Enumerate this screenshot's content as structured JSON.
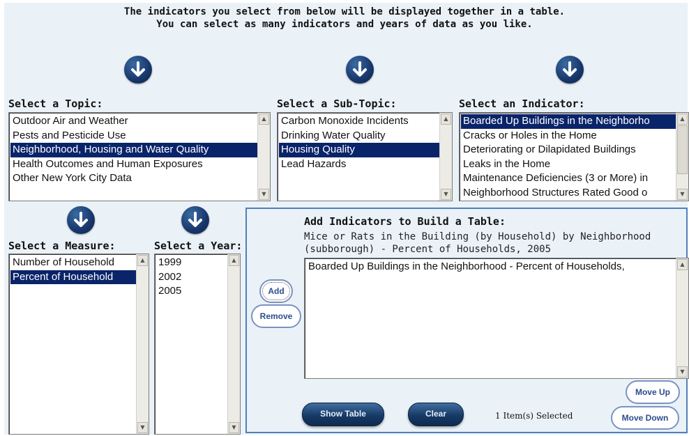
{
  "intro": {
    "line1": "The indicators you select from below will be displayed together in a table.",
    "line2": "You can select as many indicators and years of data as you like."
  },
  "topic": {
    "label": "Select a Topic:",
    "options": [
      {
        "text": "Outdoor Air and Weather",
        "selected": false
      },
      {
        "text": "Pests and Pesticide Use",
        "selected": false
      },
      {
        "text": "Neighborhood, Housing and Water Quality",
        "selected": true
      },
      {
        "text": "Health Outcomes and Human Exposures",
        "selected": false
      },
      {
        "text": "Other New York City Data",
        "selected": false
      }
    ]
  },
  "subtopic": {
    "label": "Select a Sub-Topic:",
    "options": [
      {
        "text": "Carbon Monoxide Incidents",
        "selected": false
      },
      {
        "text": "Drinking Water Quality",
        "selected": false
      },
      {
        "text": "Housing Quality",
        "selected": true
      },
      {
        "text": "Lead Hazards",
        "selected": false
      }
    ]
  },
  "indicator": {
    "label": "Select an Indicator:",
    "options": [
      {
        "text": "Boarded Up Buildings in the Neighborho",
        "selected": true
      },
      {
        "text": "Cracks or Holes in the Home",
        "selected": false
      },
      {
        "text": "Deteriorating or Dilapidated Buildings",
        "selected": false
      },
      {
        "text": "Leaks in the Home",
        "selected": false
      },
      {
        "text": "Maintenance Deficiencies (3 or More) in",
        "selected": false
      },
      {
        "text": "Neighborhood Structures Rated Good o",
        "selected": false
      }
    ]
  },
  "measure": {
    "label": "Select a Measure:",
    "options": [
      {
        "text": "Number of Household",
        "selected": false
      },
      {
        "text": "Percent of Household",
        "selected": true
      }
    ]
  },
  "year": {
    "label": "Select a Year:",
    "options": [
      {
        "text": "1999",
        "selected": false
      },
      {
        "text": "2002",
        "selected": false
      },
      {
        "text": "2005",
        "selected": false
      }
    ]
  },
  "build": {
    "title": "Add Indicators to Build a Table:",
    "description": "Mice or Rats in the Building (by Household) by Neighborhood (subborough) - Percent of Households, 2005",
    "items": [
      {
        "text": "Boarded Up Buildings in the Neighborhood - Percent of Households,"
      }
    ],
    "add_label": "Add",
    "remove_label": "Remove",
    "move_up_label": "Move Up",
    "move_down_label": "Move Down",
    "show_table_label": "Show Table",
    "clear_label": "Clear",
    "count_text": "1 Item(s) Selected"
  },
  "icons": {
    "arrow": "down-arrow-circle-icon",
    "scroll_up": "scroll-up-icon",
    "scroll_down": "scroll-down-icon"
  },
  "colors": {
    "panel_bg": "#eaf2f8",
    "selection": "#0a246a",
    "button_dark": "#173a66",
    "frame": "#4f80b8"
  }
}
